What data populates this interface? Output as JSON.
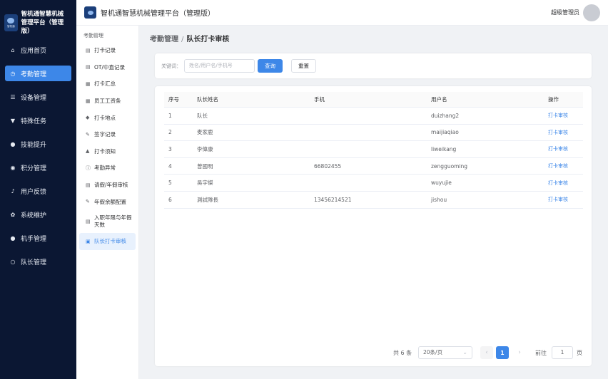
{
  "brand": {
    "line1": "智机通智慧机械",
    "line2": "管理平台（管理版）",
    "logo_text": "智机通"
  },
  "nav": [
    {
      "label": "应用首页",
      "icon": "home-icon",
      "glyph": "⌂"
    },
    {
      "label": "考勤管理",
      "icon": "clock-icon",
      "glyph": "◷",
      "active": true
    },
    {
      "label": "设备管理",
      "icon": "sliders-icon",
      "glyph": "☰"
    },
    {
      "label": "特殊任务",
      "icon": "task-icon",
      "glyph": "▼"
    },
    {
      "label": "技能提升",
      "icon": "user-icon",
      "glyph": "●"
    },
    {
      "label": "积分管理",
      "icon": "database-icon",
      "glyph": "◉"
    },
    {
      "label": "用户反馈",
      "icon": "bell-icon",
      "glyph": "♪"
    },
    {
      "label": "系统维护",
      "icon": "gear-icon",
      "glyph": "✿"
    },
    {
      "label": "机手管理",
      "icon": "person-icon",
      "glyph": "●"
    },
    {
      "label": "队长管理",
      "icon": "person-outline-icon",
      "glyph": "○"
    }
  ],
  "submenu": {
    "title": "考勤管理",
    "items": [
      {
        "label": "打卡记录",
        "icon": "list-icon",
        "glyph": "▤"
      },
      {
        "label": "OT/中直记录",
        "icon": "document-icon",
        "glyph": "▤"
      },
      {
        "label": "打卡汇总",
        "icon": "calendar-icon",
        "glyph": "▦"
      },
      {
        "label": "员工工资条",
        "icon": "table-icon",
        "glyph": "▦"
      },
      {
        "label": "打卡地点",
        "icon": "location-icon",
        "glyph": "◆"
      },
      {
        "label": "签字记录",
        "icon": "edit-icon",
        "glyph": "✎"
      },
      {
        "label": "打卡须知",
        "icon": "warning-icon",
        "glyph": "▲"
      },
      {
        "label": "考勤异常",
        "icon": "info-icon",
        "glyph": "ⓘ"
      },
      {
        "label": "请假/年假审核",
        "icon": "file-icon",
        "glyph": "▤"
      },
      {
        "label": "年假余额配置",
        "icon": "edit-doc-icon",
        "glyph": "✎"
      },
      {
        "label": "入职年限与年假天数",
        "icon": "list-icon",
        "glyph": "▤"
      },
      {
        "label": "队长打卡审核",
        "icon": "briefcase-icon",
        "glyph": "▣",
        "active": true
      }
    ]
  },
  "topbar": {
    "title": "智机通智慧机械管理平台（管理版）",
    "user": "超级管理员"
  },
  "breadcrumb": {
    "parent": "考勤管理",
    "separator": "/",
    "current": "队长打卡审核"
  },
  "search": {
    "label": "关键词：",
    "placeholder": "姓名/用户名/手机号",
    "query_label": "查询",
    "reset_label": "重置"
  },
  "table": {
    "headers": [
      "序号",
      "队长姓名",
      "手机",
      "用户名",
      "操作"
    ],
    "rows": [
      {
        "no": "1",
        "name": "队长",
        "phone": "",
        "username": "duizhang2",
        "action": "打卡审核"
      },
      {
        "no": "2",
        "name": "麦家鹿",
        "phone": "",
        "username": "maijiaqiao",
        "action": "打卡审核"
      },
      {
        "no": "3",
        "name": "李偉康",
        "phone": "",
        "username": "liweikang",
        "action": "打卡审核"
      },
      {
        "no": "4",
        "name": "曾國明",
        "phone": "66802455",
        "username": "zengguoming",
        "action": "打卡审核"
      },
      {
        "no": "5",
        "name": "吳宇傑",
        "phone": "",
        "username": "wuyujie",
        "action": "打卡审核"
      },
      {
        "no": "6",
        "name": "測試隊長",
        "phone": "13456214521",
        "username": "jishou",
        "action": "打卡审核"
      }
    ]
  },
  "pagination": {
    "total": "共 6 条",
    "page_size": "20条/页",
    "current_page": "1",
    "prev": "‹",
    "next": "›",
    "goto_label": "前往",
    "goto_value": "1",
    "unit": "页"
  }
}
